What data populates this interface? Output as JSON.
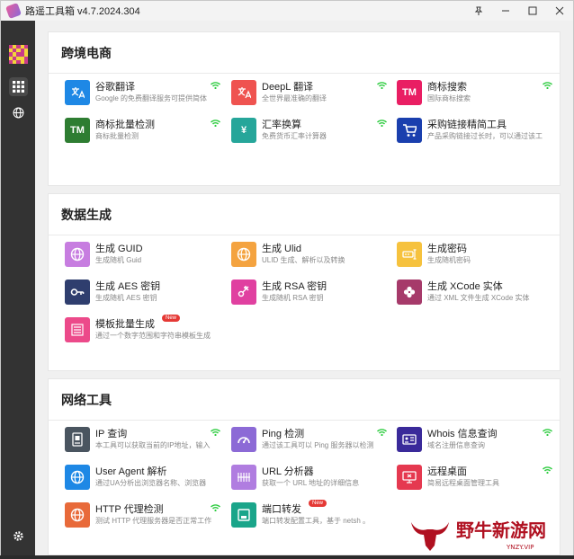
{
  "window": {
    "title": "路遥工具箱 v4.7.2024.304"
  },
  "colors": {
    "accent_wifi": "#2ecc40"
  },
  "sections": [
    {
      "title": "跨境电商",
      "tools": [
        {
          "name": "谷歌翻译",
          "desc": "Google 的免费翻译服务可提供简体",
          "icon": "translate-icon",
          "color": "#1e88e5",
          "wifi": true
        },
        {
          "name": "DeepL 翻译",
          "desc": "全世界最准确的翻译",
          "icon": "translate-icon",
          "color": "#ef5350",
          "wifi": true
        },
        {
          "name": "商标搜索",
          "desc": "国际商标搜索",
          "icon": "tm-icon",
          "color": "#e91e63",
          "icon_text": "TM",
          "wifi": true
        },
        {
          "name": "商标批量检测",
          "desc": "商标批量检测",
          "icon": "tm-icon",
          "color": "#2e7d32",
          "icon_text": "TM",
          "wifi": true
        },
        {
          "name": "汇率换算",
          "desc": "免费货币汇率计算器",
          "icon": "yen-icon",
          "color": "#26a69a",
          "icon_text": "¥",
          "wifi": true
        },
        {
          "name": "采购链接精简工具",
          "desc": "产品采购链接过长时，可以通过该工",
          "icon": "cart-icon",
          "color": "#1a3fae",
          "wifi": false
        }
      ]
    },
    {
      "title": "数据生成",
      "tools": [
        {
          "name": "生成 GUID",
          "desc": "生成随机 Guid",
          "icon": "globe-icon",
          "color": "#c77de0",
          "wifi": false
        },
        {
          "name": "生成 Ulid",
          "desc": "ULID 生成、解析以及转换",
          "icon": "globe-icon",
          "color": "#f4a340",
          "wifi": false
        },
        {
          "name": "生成密码",
          "desc": "生成随机密码",
          "icon": "password-icon",
          "color": "#f6c23e",
          "wifi": false
        },
        {
          "name": "生成 AES 密钥",
          "desc": "生成随机 AES 密钥",
          "icon": "key-icon",
          "color": "#2f3e6e",
          "wifi": false
        },
        {
          "name": "生成 RSA 密钥",
          "desc": "生成随机 RSA 密钥",
          "icon": "key-plus-icon",
          "color": "#e040a0",
          "wifi": false
        },
        {
          "name": "生成 XCode 实体",
          "desc": "通过 XML 文件生成 XCode 实体",
          "icon": "clover-icon",
          "color": "#a63a6a",
          "wifi": false
        },
        {
          "name": "模板批量生成",
          "desc": "通过一个数字范围和字符串模板生成",
          "icon": "template-icon",
          "color": "#ec4a8a",
          "wifi": false,
          "badge": "New"
        }
      ]
    },
    {
      "title": "网络工具",
      "tools": [
        {
          "name": "IP 查询",
          "desc": "本工具可以获取当前的IP地址，输入",
          "icon": "ip-icon",
          "color": "#4a5560",
          "wifi": true
        },
        {
          "name": "Ping 检测",
          "desc": "通过该工具可以 Ping 服务器以检测",
          "icon": "gauge-icon",
          "color": "#8c6ad6",
          "wifi": true
        },
        {
          "name": "Whois 信息查询",
          "desc": "域名注册信息查询",
          "icon": "id-card-icon",
          "color": "#3a2a9a",
          "wifi": true
        },
        {
          "name": "User Agent 解析",
          "desc": "通过UA分析出浏览器名称、浏览器",
          "icon": "globe-icon",
          "color": "#1e88e5",
          "wifi": false
        },
        {
          "name": "URL 分析器",
          "desc": "获取一个 URL 地址的详细信息",
          "icon": "url-icon",
          "color": "#b07de0",
          "wifi": false
        },
        {
          "name": "远程桌面",
          "desc": "简易远程桌面管理工具",
          "icon": "remote-desktop-icon",
          "color": "#e53950",
          "wifi": true
        },
        {
          "name": "HTTP 代理检测",
          "desc": "测试 HTTP 代理服务器是否正常工作",
          "icon": "globe-icon",
          "color": "#e86a3a",
          "wifi": true
        },
        {
          "name": "端口转发",
          "desc": "端口转发配置工具，基于 netsh 。",
          "icon": "port-icon",
          "color": "#1aa58a",
          "wifi": false,
          "badge": "New"
        }
      ]
    }
  ],
  "watermark": {
    "text": "野牛新游网",
    "sub": "YNZY.VIP"
  }
}
